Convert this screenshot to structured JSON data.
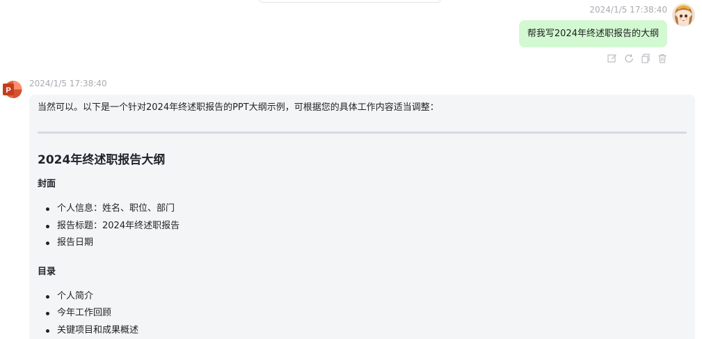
{
  "user_message": {
    "timestamp": "2024/1/5 17:38:40",
    "text": "帮我写2024年终述职报告的大纲",
    "actions": [
      "edit-icon",
      "refresh-icon",
      "copy-icon",
      "delete-icon"
    ]
  },
  "bot_message": {
    "timestamp": "2024/1/5 17:38:40",
    "avatar_letter": "P",
    "intro": "当然可以。以下是一个针对2024年终述职报告的PPT大纲示例，可根据您的具体工作内容适当调整：",
    "doc_title": "2024年终述职报告大纲",
    "sections": [
      {
        "title": "封面",
        "items": [
          "个人信息：姓名、职位、部门",
          "报告标题：2024年终述职报告",
          "报告日期"
        ]
      },
      {
        "title": "目录",
        "items": [
          "个人简介",
          "今年工作回顾",
          "关键项目和成果概述"
        ]
      }
    ]
  },
  "colors": {
    "user_bubble": "#d2f9d1",
    "bot_bubble": "#f4f5f7",
    "timestamp": "#a9abb1",
    "divider": "#d6d9e2",
    "ppt_brand": "#d24726"
  }
}
